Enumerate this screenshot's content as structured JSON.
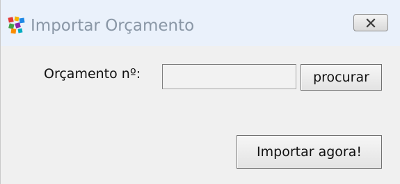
{
  "window": {
    "title": "Importar Orçamento",
    "app_icon": "colorful-windows-app-icon",
    "close_icon": "close-icon"
  },
  "form": {
    "budget_label": "Orçamento nº:",
    "budget_input_value": "",
    "search_button_label": "procurar",
    "import_button_label": "Importar agora!"
  }
}
